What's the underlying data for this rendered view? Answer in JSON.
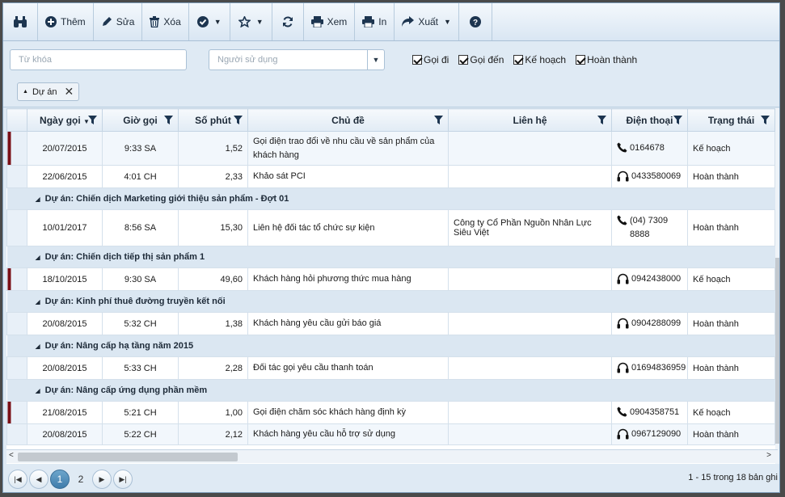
{
  "toolbar": {
    "them": "Thêm",
    "sua": "Sửa",
    "xoa": "Xóa",
    "xem": "Xem",
    "in": "In",
    "xuat": "Xuất"
  },
  "filters": {
    "keyword_placeholder": "Từ khóa",
    "user_placeholder": "Người sử dụng",
    "checks": [
      "Gọi đi",
      "Gọi đến",
      "Kế hoạch",
      "Hoàn thành"
    ]
  },
  "group_chip": {
    "label": "Dự án"
  },
  "columns": [
    "Ngày gọi",
    "Giờ gọi",
    "Số phút",
    "Chủ đề",
    "Liên hệ",
    "Điện thoại",
    "Trạng thái"
  ],
  "rows": [
    {
      "type": "row",
      "mark": true,
      "date": "20/07/2015",
      "time": "9:33 SA",
      "mins": "1,52",
      "subject": "Gọi điện trao đổi về nhu cầu về sản phẩm của khách hàng",
      "contact": "",
      "icon": "phone",
      "phone": "0164678",
      "status": "Kế hoạch",
      "h": 42,
      "alt": true
    },
    {
      "type": "row",
      "mark": false,
      "date": "22/06/2015",
      "time": "4:01 CH",
      "mins": "2,33",
      "subject": "Khảo sát PCI",
      "contact": "",
      "icon": "headset",
      "phone": "0433580069",
      "status": "Hoàn thành",
      "h": 28,
      "alt": false
    },
    {
      "type": "group",
      "label": "Dự án: Chiến dịch Marketing giới thiệu sản phẩm - Đợt 01"
    },
    {
      "type": "row",
      "mark": false,
      "date": "10/01/2017",
      "time": "8:56 SA",
      "mins": "15,30",
      "subject": "Liên hệ đối tác tổ chức sự kiện",
      "contact": "Công ty Cổ Phần Nguồn Nhân Lực Siêu Việt",
      "icon": "phone",
      "phone": "(04) 7309 8888",
      "status": "Hoàn thành",
      "h": 45,
      "alt": false
    },
    {
      "type": "group",
      "label": "Dự án: Chiến dịch tiếp thị sản phẩm 1"
    },
    {
      "type": "row",
      "mark": true,
      "date": "18/10/2015",
      "time": "9:30 SA",
      "mins": "49,60",
      "subject": "Khách hàng hỏi phương thức mua hàng",
      "contact": "",
      "icon": "headset",
      "phone": "0942438000",
      "status": "Kế hoạch",
      "h": 28,
      "alt": false
    },
    {
      "type": "group",
      "label": "Dự án: Kinh phí thuê đường truyền kết nối"
    },
    {
      "type": "row",
      "mark": false,
      "date": "20/08/2015",
      "time": "5:32 CH",
      "mins": "1,38",
      "subject": "Khách hàng yêu cầu gửi báo giá",
      "contact": "",
      "icon": "headset",
      "phone": "0904288099",
      "status": "Hoàn thành",
      "h": 28,
      "alt": false
    },
    {
      "type": "group",
      "label": "Dự án: Nâng cấp hạ tầng năm 2015"
    },
    {
      "type": "row",
      "mark": false,
      "date": "20/08/2015",
      "time": "5:33 CH",
      "mins": "2,28",
      "subject": "Đối tác gọi yêu cầu thanh toán",
      "contact": "",
      "icon": "headset",
      "phone": "01694836959",
      "status": "Hoàn thành",
      "h": 28,
      "alt": false
    },
    {
      "type": "group",
      "label": "Dự án: Nâng cấp ứng dụng phần mềm"
    },
    {
      "type": "row",
      "mark": true,
      "date": "21/08/2015",
      "time": "5:21 CH",
      "mins": "1,00",
      "subject": "Gọi điện chăm sóc khách hàng định kỳ",
      "contact": "",
      "icon": "phone",
      "phone": "0904358751",
      "status": "Kế hoạch",
      "h": 28,
      "alt": false
    },
    {
      "type": "row",
      "mark": false,
      "date": "20/08/2015",
      "time": "5:22 CH",
      "mins": "2,12",
      "subject": "Khách hàng yêu cầu hỗ trợ sử dụng",
      "contact": "",
      "icon": "headset",
      "phone": "0967129090",
      "status": "Hoàn thành",
      "h": 26,
      "alt": true
    }
  ],
  "pager": {
    "pages": [
      "1",
      "2"
    ],
    "current": "1",
    "info": "1 - 15 trong 18 bản ghi"
  }
}
